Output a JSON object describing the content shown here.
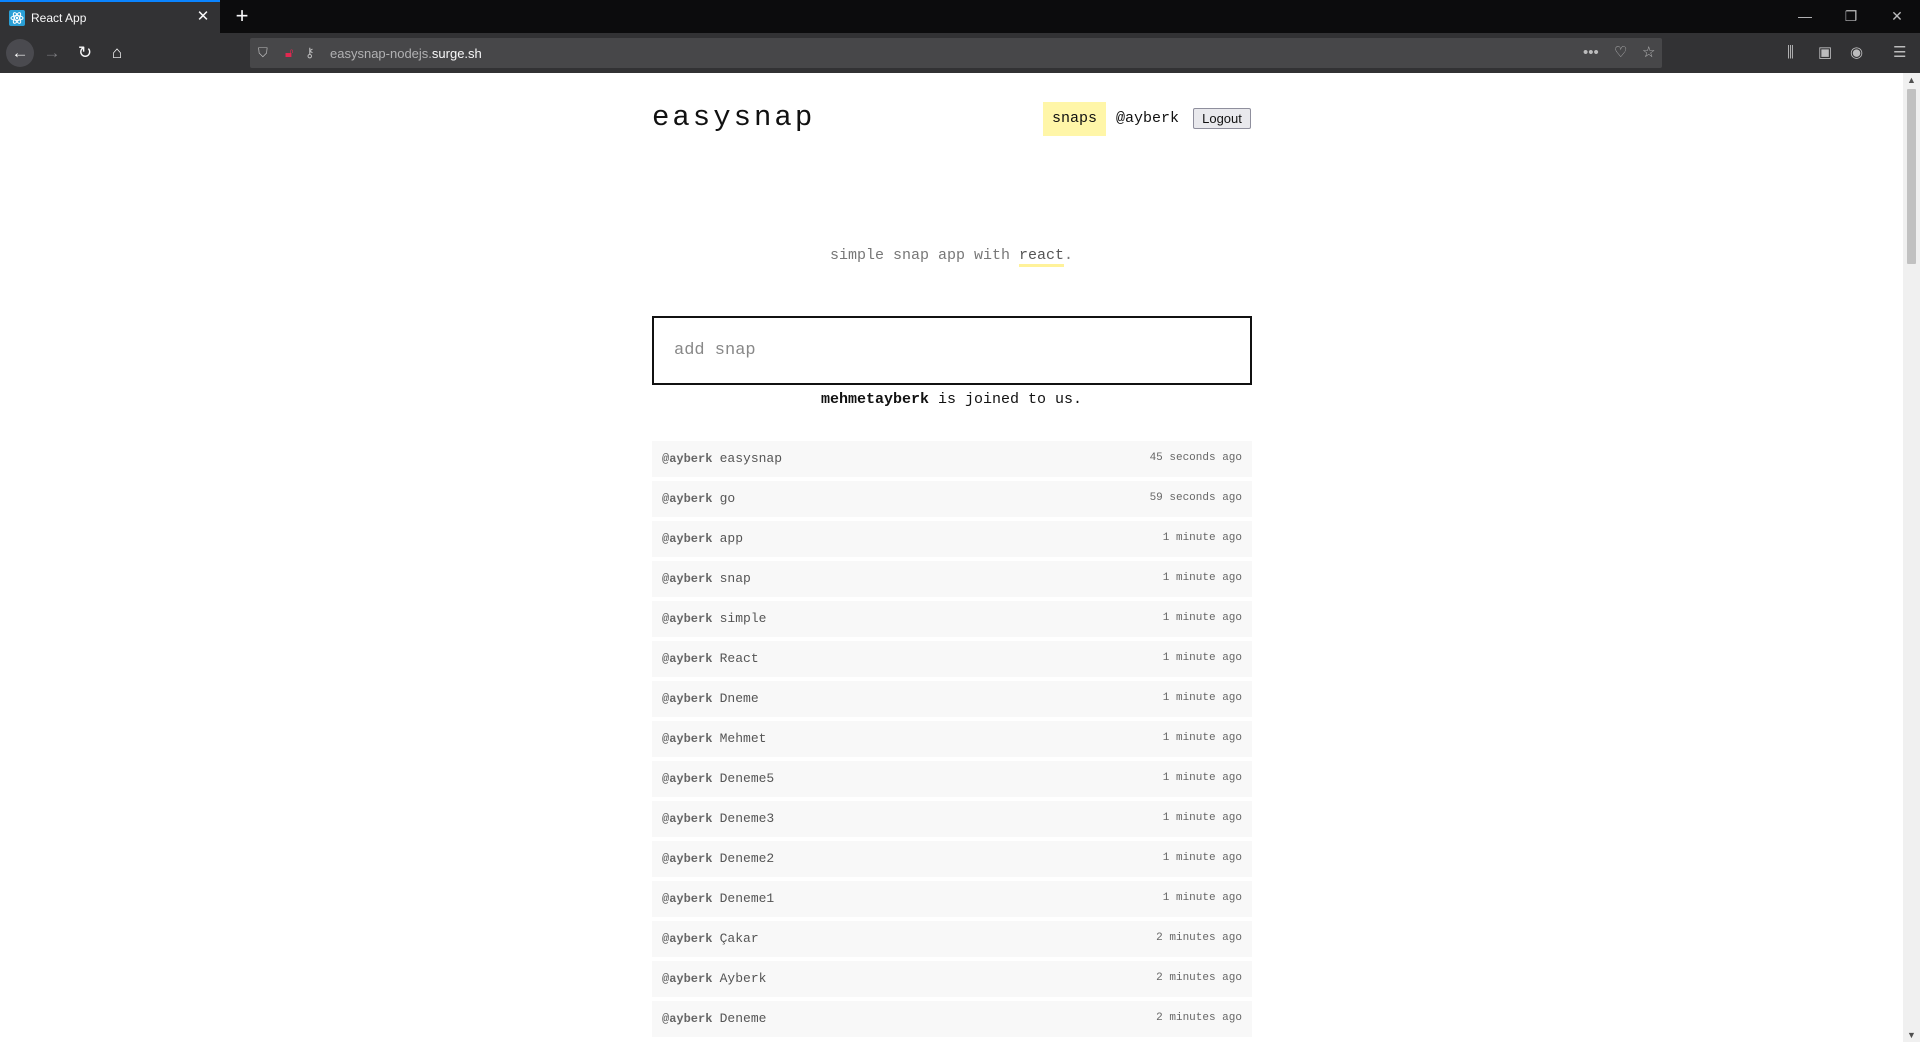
{
  "browser": {
    "tab_title": "React App",
    "url_prefix": "easysnap-nodejs.",
    "url_domain": "surge.sh"
  },
  "app": {
    "brand": "easysnap",
    "nav": {
      "snaps": "snaps",
      "user": "@ayberk",
      "logout": "Logout"
    },
    "tagline": {
      "before": "simple snap app with ",
      "highlight": "react",
      "after": "."
    },
    "input_placeholder": "add snap",
    "joined": {
      "username": "mehmetayberk",
      "text": " is joined to us."
    },
    "snaps": [
      {
        "user": "@ayberk",
        "text": "easysnap",
        "time": "45 seconds ago"
      },
      {
        "user": "@ayberk",
        "text": "go",
        "time": "59 seconds ago"
      },
      {
        "user": "@ayberk",
        "text": "app",
        "time": "1 minute ago"
      },
      {
        "user": "@ayberk",
        "text": "snap",
        "time": "1 minute ago"
      },
      {
        "user": "@ayberk",
        "text": "simple",
        "time": "1 minute ago"
      },
      {
        "user": "@ayberk",
        "text": "React",
        "time": "1 minute ago"
      },
      {
        "user": "@ayberk",
        "text": "Dneme",
        "time": "1 minute ago"
      },
      {
        "user": "@ayberk",
        "text": "Mehmet",
        "time": "1 minute ago"
      },
      {
        "user": "@ayberk",
        "text": "Deneme5",
        "time": "1 minute ago"
      },
      {
        "user": "@ayberk",
        "text": "Deneme3",
        "time": "1 minute ago"
      },
      {
        "user": "@ayberk",
        "text": "Deneme2",
        "time": "1 minute ago"
      },
      {
        "user": "@ayberk",
        "text": "Deneme1",
        "time": "1 minute ago"
      },
      {
        "user": "@ayberk",
        "text": "Çakar",
        "time": "2 minutes ago"
      },
      {
        "user": "@ayberk",
        "text": "Ayberk",
        "time": "2 minutes ago"
      },
      {
        "user": "@ayberk",
        "text": "Deneme",
        "time": "2 minutes ago"
      }
    ]
  }
}
